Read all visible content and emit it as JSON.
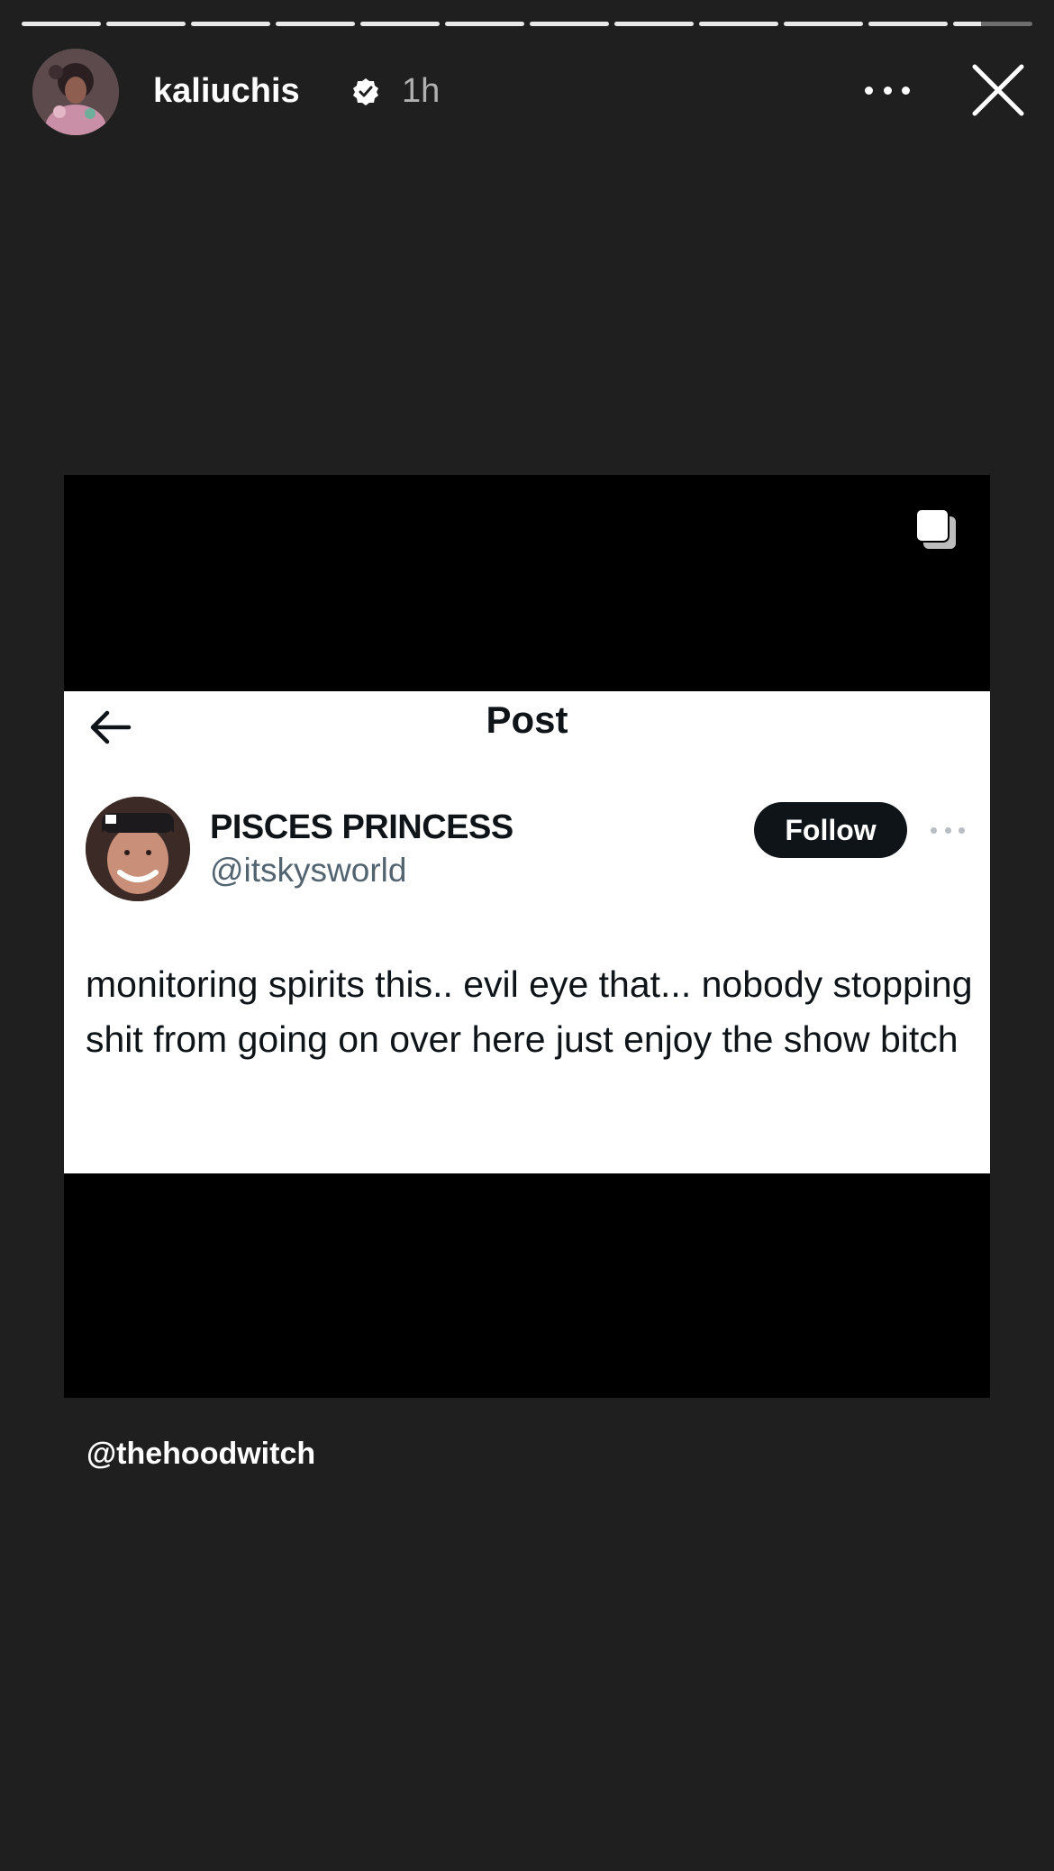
{
  "story": {
    "segments": 12,
    "current_segment_progress": 0.35
  },
  "header": {
    "username": "kaliuchis",
    "time": "1h",
    "icons": {
      "verified": "verified-badge-icon",
      "more": "more-options-icon",
      "close": "close-icon"
    }
  },
  "media": {
    "icons": {
      "carousel": "multiple-items-icon"
    },
    "tweet": {
      "title": "Post",
      "display_name": "PISCES PRINCESS",
      "handle": "@itskysworld",
      "follow_label": "Follow",
      "body": "monitoring spirits this.. evil eye that... nobody stopping shit from going on over here just enjoy the show bitch"
    }
  },
  "mention": "@thehoodwitch",
  "colors": {
    "background": "#1f1f1f",
    "media_bg": "#000000",
    "tweet_bg": "#ffffff",
    "tweet_text": "#0f1419",
    "handle_text": "#536471"
  }
}
